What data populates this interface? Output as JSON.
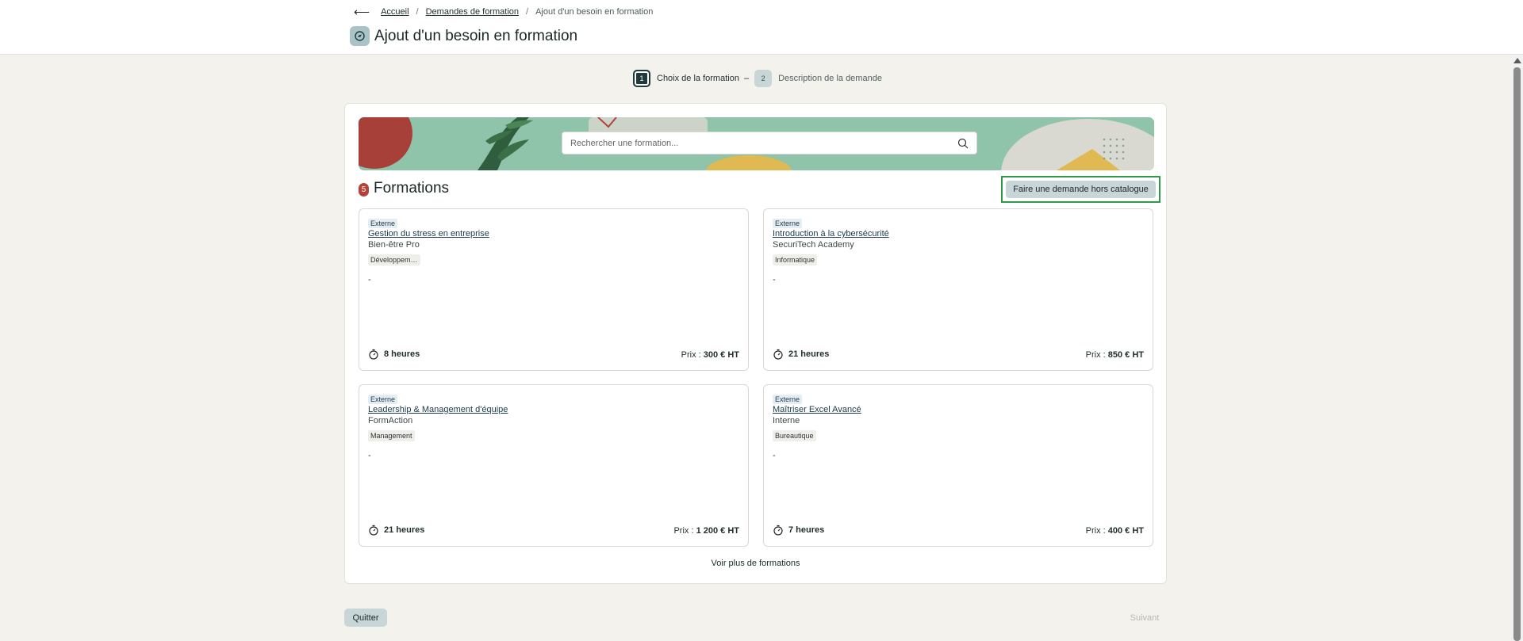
{
  "breadcrumb": {
    "home": "Accueil",
    "parent": "Demandes de formation",
    "current": "Ajout d'un besoin en formation"
  },
  "page": {
    "title": "Ajout d'un besoin en formation"
  },
  "stepper": [
    {
      "num": "1",
      "label": "Choix de la formation",
      "active": true
    },
    {
      "num": "2",
      "label": "Description de la demande",
      "active": false
    }
  ],
  "search": {
    "placeholder": "Rechercher une formation..."
  },
  "formations": {
    "count": "5",
    "title": "Formations",
    "hors_catalogue": "Faire une demande hors catalogue",
    "voir_plus": "Voir plus de formations",
    "items": [
      {
        "tag": "Externe",
        "title": "Gestion du stress en entreprise",
        "org": "Bien-être Pro",
        "category": "Développem…",
        "desc": "-",
        "duration": "8 heures",
        "price_label": "Prix : ",
        "price": "300 € HT"
      },
      {
        "tag": "Externe",
        "title": "Introduction à la cybersécurité",
        "org": "SecuriTech Academy",
        "category": "Informatique",
        "desc": "-",
        "duration": "21 heures",
        "price_label": "Prix : ",
        "price": "850 € HT"
      },
      {
        "tag": "Externe",
        "title": "Leadership & Management d'équipe",
        "org": "FormAction",
        "category": "Management",
        "desc": "-",
        "duration": "21 heures",
        "price_label": "Prix : ",
        "price": "1 200 € HT"
      },
      {
        "tag": "Externe",
        "title": "Maîtriser Excel Avancé",
        "org": "Interne",
        "category": "Bureautique",
        "desc": "-",
        "duration": "7 heures",
        "price_label": "Prix : ",
        "price": "400 € HT"
      }
    ]
  },
  "footer": {
    "quit": "Quitter",
    "next": "Suivant"
  },
  "colors": {
    "accent_dark": "#223a3d",
    "button_bg": "#c9d6d7",
    "badge_red": "#b4413a",
    "highlight_green": "#2e9a4a"
  },
  "icons": {
    "back": "arrow-left-icon",
    "title": "compass-icon",
    "search": "search-icon",
    "duration": "stopwatch-icon"
  }
}
